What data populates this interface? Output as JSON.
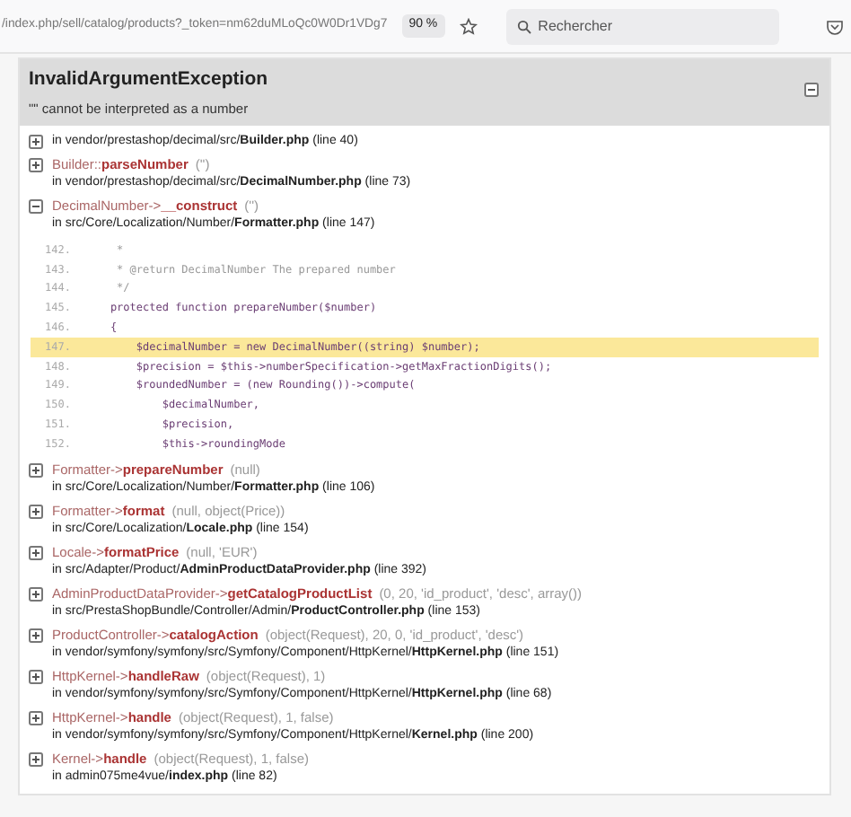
{
  "browser": {
    "url": "/index.php/sell/catalog/products?_token=nm62duMLoQc0W0Dr1VDg7",
    "zoom": "90 %",
    "search_placeholder": "Rechercher"
  },
  "exception": {
    "title": "InvalidArgumentException",
    "message": "\"\" cannot be interpreted as a number",
    "expanded": true
  },
  "trace": [
    {
      "expanded": false,
      "location": "in vendor/prestashop/decimal/src/**Builder.php** (line 40)"
    },
    {
      "expanded": false,
      "caller": "Builder::",
      "method": "parseNumber",
      "args": "('')",
      "location": "in vendor/prestashop/decimal/src/**DecimalNumber.php** (line 73)"
    },
    {
      "expanded": true,
      "caller": "DecimalNumber->",
      "method": "__construct",
      "args": "('')",
      "location": "in src/Core/Localization/Number/**Formatter.php** (line 147)",
      "code": [
        {
          "number": "142.",
          "kind": "comment",
          "text": "     *",
          "highlighted": false
        },
        {
          "number": "143.",
          "kind": "comment",
          "text": "     * @return DecimalNumber The prepared number",
          "highlighted": false
        },
        {
          "number": "144.",
          "kind": "comment",
          "text": "     */",
          "highlighted": false
        },
        {
          "number": "145.",
          "kind": "code",
          "text": "    protected function prepareNumber($number)",
          "highlighted": false
        },
        {
          "number": "146.",
          "kind": "code",
          "text": "    {",
          "highlighted": false
        },
        {
          "number": "147.",
          "kind": "code",
          "text": "        $decimalNumber = new DecimalNumber((string) $number);",
          "highlighted": true
        },
        {
          "number": "148.",
          "kind": "code",
          "text": "        $precision = $this->numberSpecification->getMaxFractionDigits();",
          "highlighted": false
        },
        {
          "number": "149.",
          "kind": "code",
          "text": "        $roundedNumber = (new Rounding())->compute(",
          "highlighted": false
        },
        {
          "number": "150.",
          "kind": "code",
          "text": "            $decimalNumber,",
          "highlighted": false
        },
        {
          "number": "151.",
          "kind": "code",
          "text": "            $precision,",
          "highlighted": false
        },
        {
          "number": "152.",
          "kind": "code",
          "text": "            $this->roundingMode",
          "highlighted": false
        }
      ]
    },
    {
      "expanded": false,
      "caller": "Formatter->",
      "method": "prepareNumber",
      "args": "(null)",
      "location": "in src/Core/Localization/Number/**Formatter.php** (line 106)"
    },
    {
      "expanded": false,
      "caller": "Formatter->",
      "method": "format",
      "args": "(null, object(Price))",
      "location": "in src/Core/Localization/**Locale.php** (line 154)"
    },
    {
      "expanded": false,
      "caller": "Locale->",
      "method": "formatPrice",
      "args": "(null, 'EUR')",
      "location": "in src/Adapter/Product/**AdminProductDataProvider.php** (line 392)"
    },
    {
      "expanded": false,
      "caller": "AdminProductDataProvider->",
      "method": "getCatalogProductList",
      "args": "(0, 20, 'id_product', 'desc', array())",
      "location": "in src/PrestaShopBundle/Controller/Admin/**ProductController.php** (line 153)"
    },
    {
      "expanded": false,
      "caller": "ProductController->",
      "method": "catalogAction",
      "args": "(object(Request), 20, 0, 'id_product', 'desc')",
      "location": "in vendor/symfony/symfony/src/Symfony/Component/HttpKernel/**HttpKernel.php** (line 151)"
    },
    {
      "expanded": false,
      "caller": "HttpKernel->",
      "method": "handleRaw",
      "args": "(object(Request), 1)",
      "location": "in vendor/symfony/symfony/src/Symfony/Component/HttpKernel/**HttpKernel.php** (line 68)"
    },
    {
      "expanded": false,
      "caller": "HttpKernel->",
      "method": "handle",
      "args": "(object(Request), 1, false)",
      "location": "in vendor/symfony/symfony/src/Symfony/Component/HttpKernel/**Kernel.php** (line 200)"
    },
    {
      "expanded": false,
      "caller": "Kernel->",
      "method": "handle",
      "args": "(object(Request), 1, false)",
      "location": "in admin075me4vue/**index.php** (line 82)"
    }
  ]
}
